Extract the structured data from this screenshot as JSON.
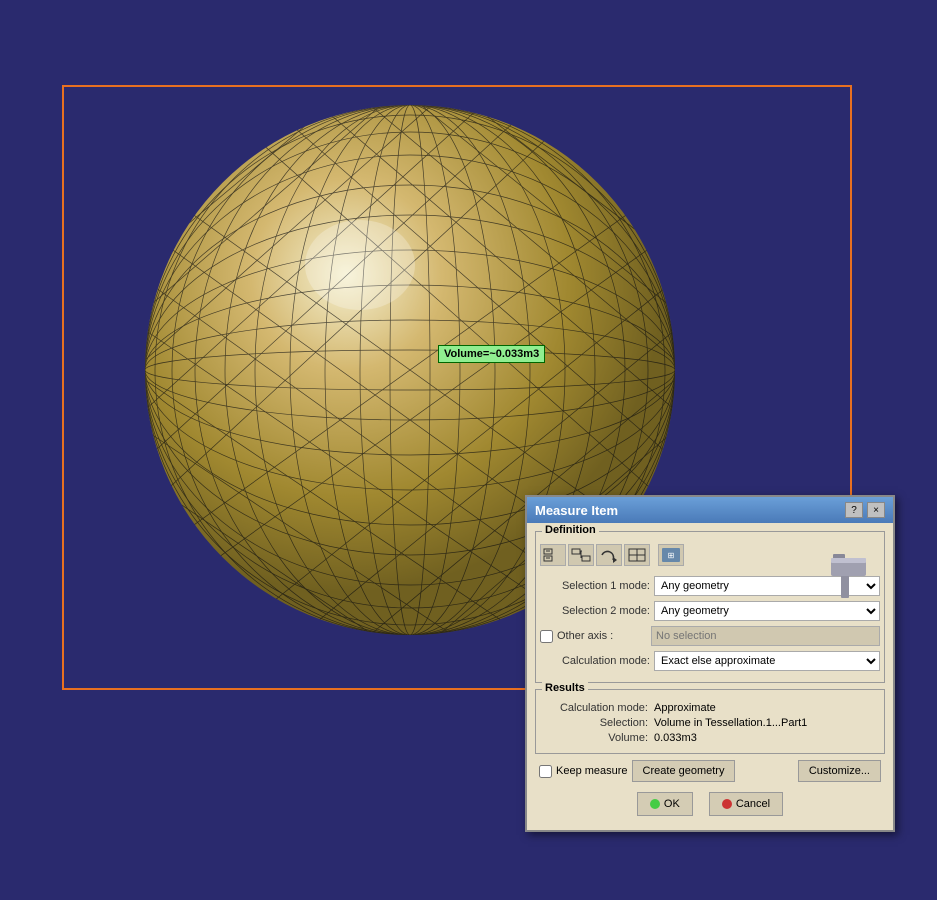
{
  "viewport": {
    "background_color": "#2a2a6e"
  },
  "volume_tooltip": {
    "text": "Volume=~0.033m3"
  },
  "dialog": {
    "title": "Measure Item",
    "close_btn": "×",
    "help_btn": "?",
    "definition_label": "Definition",
    "selection1_label": "Selection 1 mode:",
    "selection2_label": "Selection 2 mode:",
    "other_axis_label": "Other axis :",
    "calc_mode_label": "Calculation mode:",
    "keep_measure_label": "Keep measure",
    "create_geometry_label": "Create geometry",
    "customize_label": "Customize...",
    "ok_label": "OK",
    "cancel_label": "Cancel",
    "selection1_value": "Any geometry",
    "selection2_value": "Any geometry",
    "calc_mode_value": "Exact else approximate",
    "other_axis_placeholder": "No selection",
    "results_label": "Results",
    "calc_mode_result_label": "Calculation mode:",
    "calc_mode_result_value": "Approximate",
    "selection_result_label": "Selection:",
    "selection_result_value": "Volume in Tessellation.1...Part1",
    "volume_result_label": "Volume:",
    "volume_result_value": "0.033m3",
    "toolbar_icons": [
      {
        "name": "icon1",
        "symbol": "⇔"
      },
      {
        "name": "icon2",
        "symbol": "⇒"
      },
      {
        "name": "icon3",
        "symbol": "↷"
      },
      {
        "name": "icon4",
        "symbol": "▦"
      },
      {
        "name": "icon5",
        "symbol": "⊞"
      }
    ]
  }
}
